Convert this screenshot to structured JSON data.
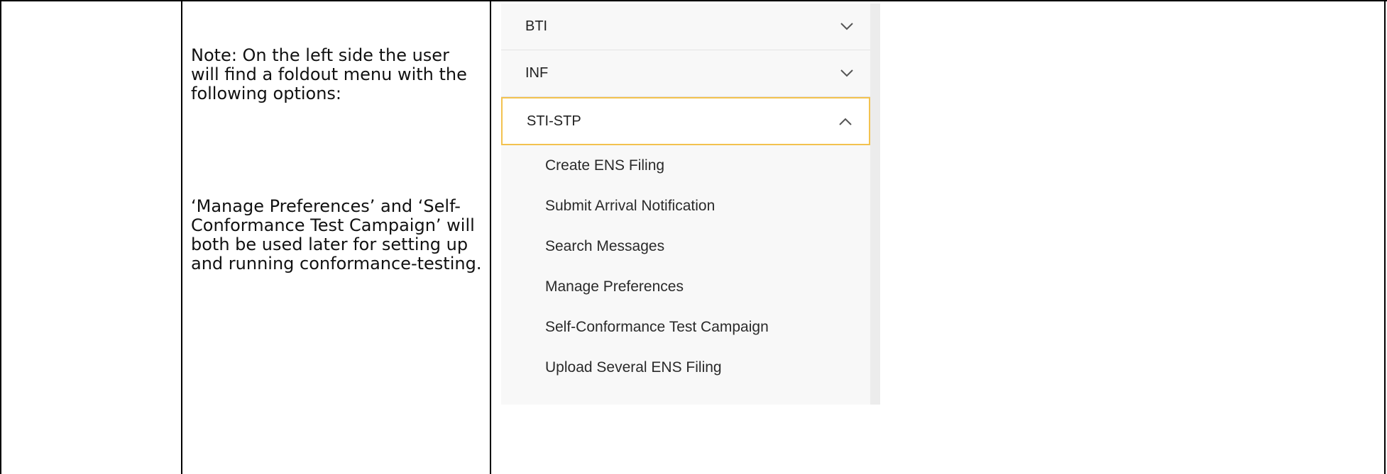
{
  "note": {
    "paragraph_1": "Note: On the left side the user will find a foldout menu with the following options:",
    "paragraph_2": "‘Manage Preferences’ and ‘Self-Conformance Test Campaign’ will both be used later for setting up and running conformance-testing."
  },
  "menu": {
    "groups": [
      {
        "label": "BTI",
        "icon": "chevron-down-icon",
        "expanded": false
      },
      {
        "label": "INF",
        "icon": "chevron-down-icon",
        "expanded": false
      },
      {
        "label": "STI-STP",
        "icon": "chevron-up-icon",
        "expanded": true
      }
    ],
    "sub_items": [
      {
        "label": "Create ENS Filing"
      },
      {
        "label": "Submit Arrival Notification"
      },
      {
        "label": "Search Messages"
      },
      {
        "label": "Manage Preferences"
      },
      {
        "label": "Self-Conformance Test Campaign"
      },
      {
        "label": "Upload Several ENS Filing"
      }
    ]
  },
  "colors": {
    "active_border": "#f3c24f",
    "menu_background": "#f8f8f8",
    "table_lines": "#000000"
  }
}
